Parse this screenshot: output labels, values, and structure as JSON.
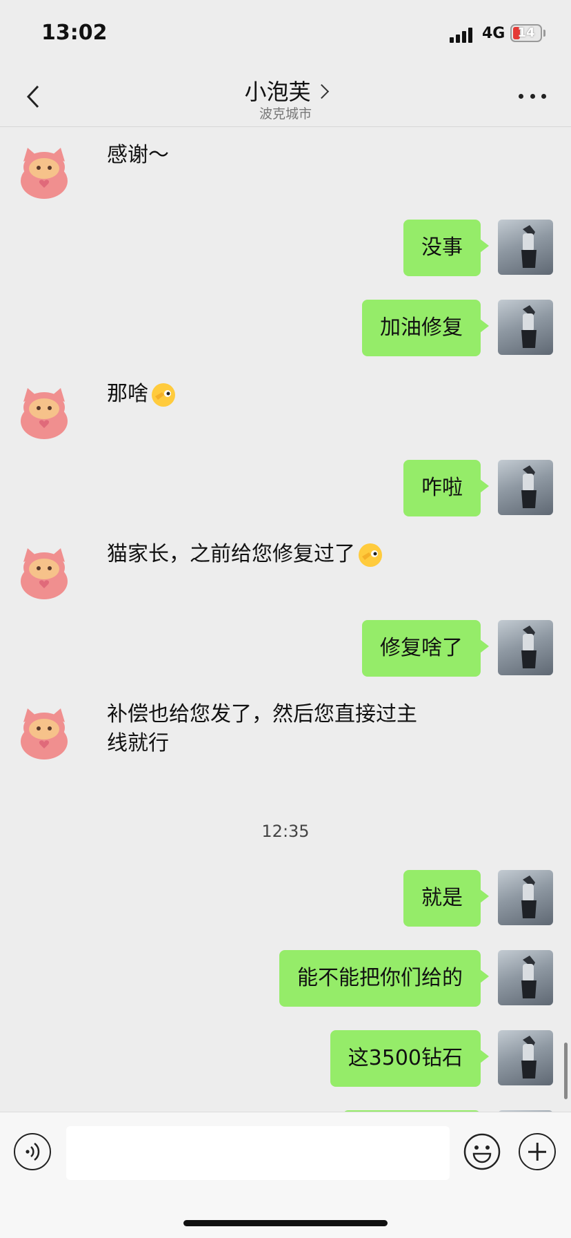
{
  "status_bar": {
    "time": "13:02",
    "network": "4G",
    "battery": "14"
  },
  "nav": {
    "title": "小泡芙",
    "subtitle": "波克城市"
  },
  "messages": [
    {
      "side": "left",
      "text": "感谢～"
    },
    {
      "side": "right",
      "text": "没事"
    },
    {
      "side": "right",
      "text": "加油修复"
    },
    {
      "side": "left",
      "text": "那啥",
      "emoji": "wink-emoji"
    },
    {
      "side": "right",
      "text": "咋啦"
    },
    {
      "side": "left",
      "text": "猫家长，之前给您修复过了",
      "emoji": "wink-emoji"
    },
    {
      "side": "right",
      "text": "修复啥了"
    },
    {
      "side": "left",
      "text": "补偿也给您发了，然后您直接过主",
      "text_line2": "线就行"
    },
    {
      "type": "timestamp",
      "text": "12:35"
    },
    {
      "side": "right",
      "text": "就是"
    },
    {
      "side": "right",
      "text": "能不能把你们给的"
    },
    {
      "side": "right",
      "text": "这3500钻石"
    }
  ],
  "input": {
    "value": "",
    "placeholder": ""
  },
  "colors": {
    "bubble_self": "#95ec69",
    "background": "#ededed"
  }
}
